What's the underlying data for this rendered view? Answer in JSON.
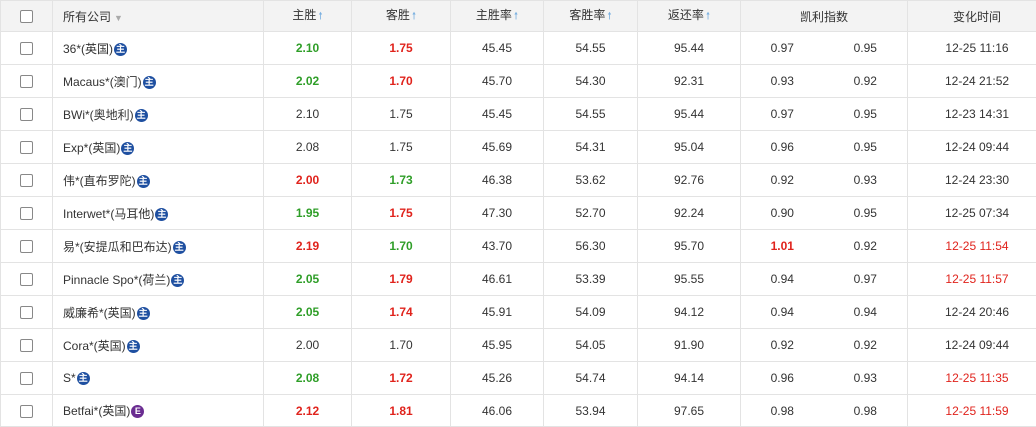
{
  "header": {
    "company": "所有公司",
    "home_win": "主胜",
    "away_win": "客胜",
    "home_rate": "主胜率",
    "away_rate": "客胜率",
    "return_rate": "返还率",
    "kelly": "凯利指数",
    "change_time": "变化时间"
  },
  "colors": {
    "green": "#2f9e28",
    "red": "#e0231c",
    "badge_main": "#1e4fa0",
    "badge_e": "#6a2c91"
  },
  "rows": [
    {
      "company": "36*(英国)",
      "badge": "主",
      "badge_type": "main",
      "home": "2.10",
      "home_color": "green",
      "away": "1.75",
      "away_color": "red",
      "home_rate": "45.45",
      "away_rate": "54.55",
      "return": "95.44",
      "k1": "0.97",
      "k1_color": "plain",
      "k2": "0.95",
      "time": "12-25 11:16",
      "time_color": "plain"
    },
    {
      "company": "Macaus*(澳门)",
      "badge": "主",
      "badge_type": "main",
      "home": "2.02",
      "home_color": "green",
      "away": "1.70",
      "away_color": "red",
      "home_rate": "45.70",
      "away_rate": "54.30",
      "return": "92.31",
      "k1": "0.93",
      "k1_color": "plain",
      "k2": "0.92",
      "time": "12-24 21:52",
      "time_color": "plain"
    },
    {
      "company": "BWi*(奥地利)",
      "badge": "主",
      "badge_type": "main",
      "home": "2.10",
      "home_color": "plain",
      "away": "1.75",
      "away_color": "plain",
      "home_rate": "45.45",
      "away_rate": "54.55",
      "return": "95.44",
      "k1": "0.97",
      "k1_color": "plain",
      "k2": "0.95",
      "time": "12-23 14:31",
      "time_color": "plain"
    },
    {
      "company": "Exp*(英国)",
      "badge": "主",
      "badge_type": "main",
      "home": "2.08",
      "home_color": "plain",
      "away": "1.75",
      "away_color": "plain",
      "home_rate": "45.69",
      "away_rate": "54.31",
      "return": "95.04",
      "k1": "0.96",
      "k1_color": "plain",
      "k2": "0.95",
      "time": "12-24 09:44",
      "time_color": "plain"
    },
    {
      "company": "伟*(直布罗陀)",
      "badge": "主",
      "badge_type": "main",
      "home": "2.00",
      "home_color": "red",
      "away": "1.73",
      "away_color": "green",
      "home_rate": "46.38",
      "away_rate": "53.62",
      "return": "92.76",
      "k1": "0.92",
      "k1_color": "plain",
      "k2": "0.93",
      "time": "12-24 23:30",
      "time_color": "plain"
    },
    {
      "company": "Interwet*(马耳他)",
      "badge": "主",
      "badge_type": "main",
      "home": "1.95",
      "home_color": "green",
      "away": "1.75",
      "away_color": "red",
      "home_rate": "47.30",
      "away_rate": "52.70",
      "return": "92.24",
      "k1": "0.90",
      "k1_color": "plain",
      "k2": "0.95",
      "time": "12-25 07:34",
      "time_color": "plain"
    },
    {
      "company": "易*(安提瓜和巴布达)",
      "badge": "主",
      "badge_type": "main",
      "home": "2.19",
      "home_color": "red",
      "away": "1.70",
      "away_color": "green",
      "home_rate": "43.70",
      "away_rate": "56.30",
      "return": "95.70",
      "k1": "1.01",
      "k1_color": "red",
      "k2": "0.92",
      "time": "12-25 11:54",
      "time_color": "red"
    },
    {
      "company": "Pinnacle Spo*(荷兰)",
      "badge": "主",
      "badge_type": "main",
      "home": "2.05",
      "home_color": "green",
      "away": "1.79",
      "away_color": "red",
      "home_rate": "46.61",
      "away_rate": "53.39",
      "return": "95.55",
      "k1": "0.94",
      "k1_color": "plain",
      "k2": "0.97",
      "time": "12-25 11:57",
      "time_color": "red"
    },
    {
      "company": "威廉希*(英国)",
      "badge": "主",
      "badge_type": "main",
      "home": "2.05",
      "home_color": "green",
      "away": "1.74",
      "away_color": "red",
      "home_rate": "45.91",
      "away_rate": "54.09",
      "return": "94.12",
      "k1": "0.94",
      "k1_color": "plain",
      "k2": "0.94",
      "time": "12-24 20:46",
      "time_color": "plain"
    },
    {
      "company": "Cora*(英国)",
      "badge": "主",
      "badge_type": "main",
      "home": "2.00",
      "home_color": "plain",
      "away": "1.70",
      "away_color": "plain",
      "home_rate": "45.95",
      "away_rate": "54.05",
      "return": "91.90",
      "k1": "0.92",
      "k1_color": "plain",
      "k2": "0.92",
      "time": "12-24 09:44",
      "time_color": "plain"
    },
    {
      "company": "S*",
      "badge": "主",
      "badge_type": "main",
      "home": "2.08",
      "home_color": "green",
      "away": "1.72",
      "away_color": "red",
      "home_rate": "45.26",
      "away_rate": "54.74",
      "return": "94.14",
      "k1": "0.96",
      "k1_color": "plain",
      "k2": "0.93",
      "time": "12-25 11:35",
      "time_color": "red"
    },
    {
      "company": "Betfai*(英国)",
      "badge": "E",
      "badge_type": "e",
      "home": "2.12",
      "home_color": "red",
      "away": "1.81",
      "away_color": "red",
      "home_rate": "46.06",
      "away_rate": "53.94",
      "return": "97.65",
      "k1": "0.98",
      "k1_color": "plain",
      "k2": "0.98",
      "time": "12-25 11:59",
      "time_color": "red"
    }
  ]
}
